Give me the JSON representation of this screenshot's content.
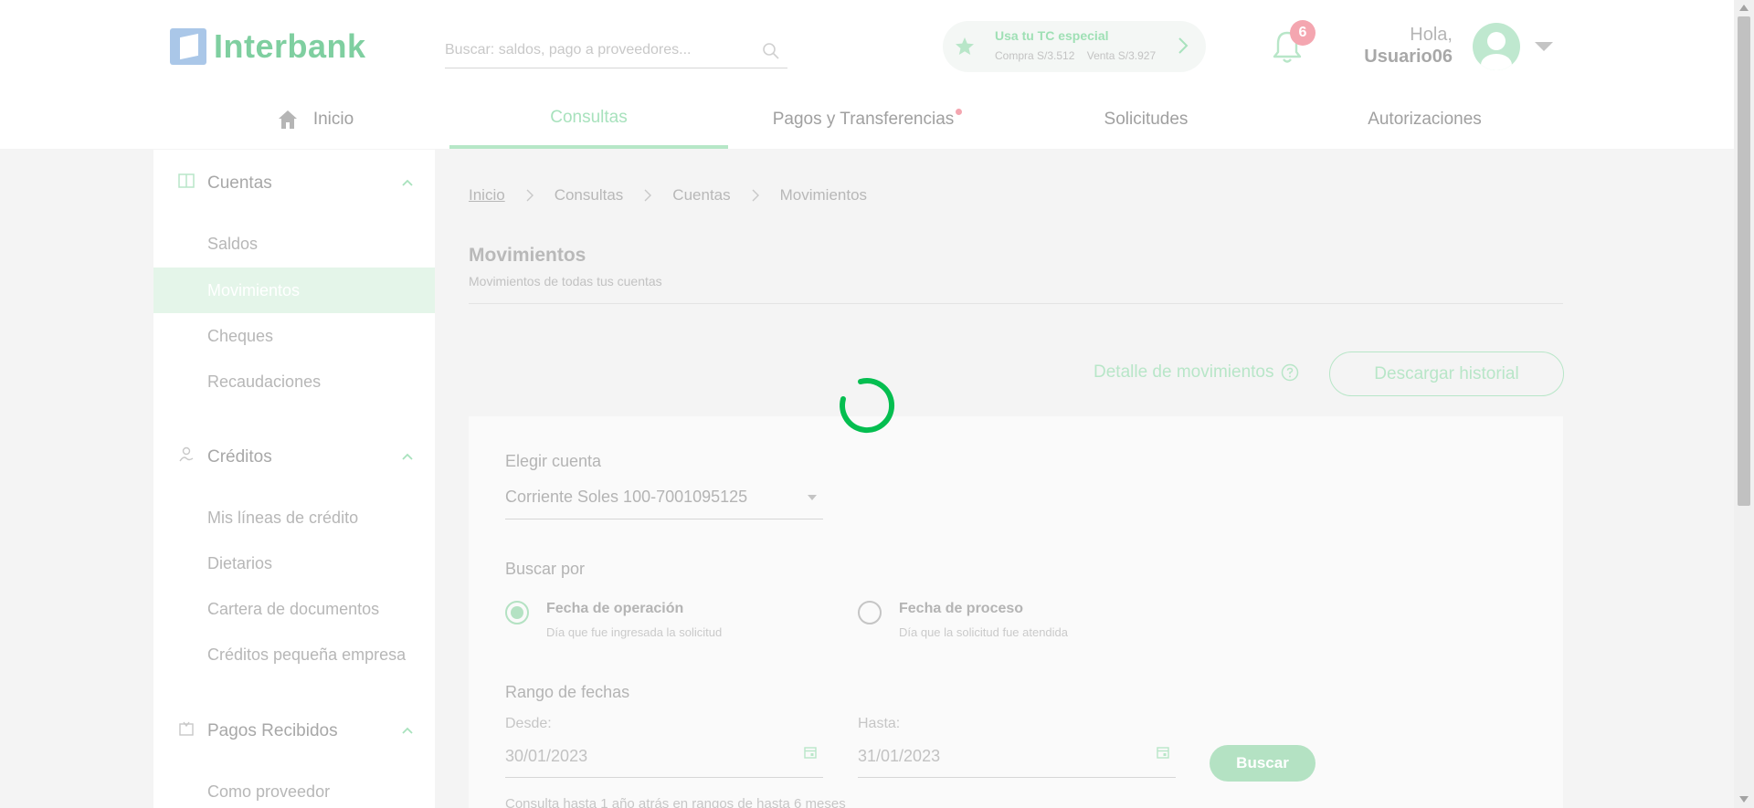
{
  "brand": {
    "name": "Interbank",
    "accent": "#05be50",
    "accent_faded": "#b4e2c3"
  },
  "search": {
    "placeholder": "Buscar: saldos, pago a proveedores..."
  },
  "exchange_promo": {
    "title": "Usa tu TC especial",
    "buy": "Compra S/3.512",
    "sell": "Venta S/3.927"
  },
  "notifications": {
    "count": "6"
  },
  "user": {
    "greeting": "Hola,",
    "name": "Usuario06"
  },
  "nav": {
    "items": [
      {
        "label": "Inicio",
        "icon": "home-icon",
        "active": false
      },
      {
        "label": "Consultas",
        "active": true
      },
      {
        "label": "Pagos y Transferencias",
        "has_dot": true,
        "active": false
      },
      {
        "label": "Solicitudes",
        "active": false
      },
      {
        "label": "Autorizaciones",
        "active": false
      }
    ]
  },
  "sidebar": {
    "sections": [
      {
        "label": "Cuentas",
        "icon": "accounts-icon",
        "expanded": true,
        "items": [
          "Saldos",
          "Movimientos",
          "Cheques",
          "Recaudaciones"
        ]
      },
      {
        "label": "Créditos",
        "icon": "credits-icon",
        "expanded": true,
        "items": [
          "Mis líneas de crédito",
          "Dietarios",
          "Cartera de documentos",
          "Créditos pequeña empresa"
        ]
      },
      {
        "label": "Pagos Recibidos",
        "icon": "payments-received-icon",
        "expanded": true,
        "items": [
          "Como proveedor"
        ]
      }
    ],
    "active_item": "Movimientos"
  },
  "breadcrumb": [
    "Inicio",
    "Consultas",
    "Cuentas",
    "Movimientos"
  ],
  "page": {
    "title": "Movimientos",
    "subtitle": "Movimientos de todas tus cuentas",
    "detail_link": "Detalle de movimientos",
    "download_button": "Descargar  historial"
  },
  "form": {
    "account_label": "Elegir cuenta",
    "account_value": "Corriente Soles 100-7001095125",
    "search_by_label": "Buscar por",
    "options": [
      {
        "title": "Fecha de operación",
        "desc": "Día que fue ingresada la solicitud",
        "checked": true
      },
      {
        "title": "Fecha de proceso",
        "desc": "Día que la solicitud fue atendida",
        "checked": false
      }
    ],
    "range_label": "Rango de fechas",
    "from_label": "Desde:",
    "from_value": "30/01/2023",
    "to_label": "Hasta:",
    "to_value": "31/01/2023",
    "search_button": "Buscar",
    "footnote": "Consulta hasta 1 año atrás en rangos de hasta 6 meses"
  },
  "loading": true
}
